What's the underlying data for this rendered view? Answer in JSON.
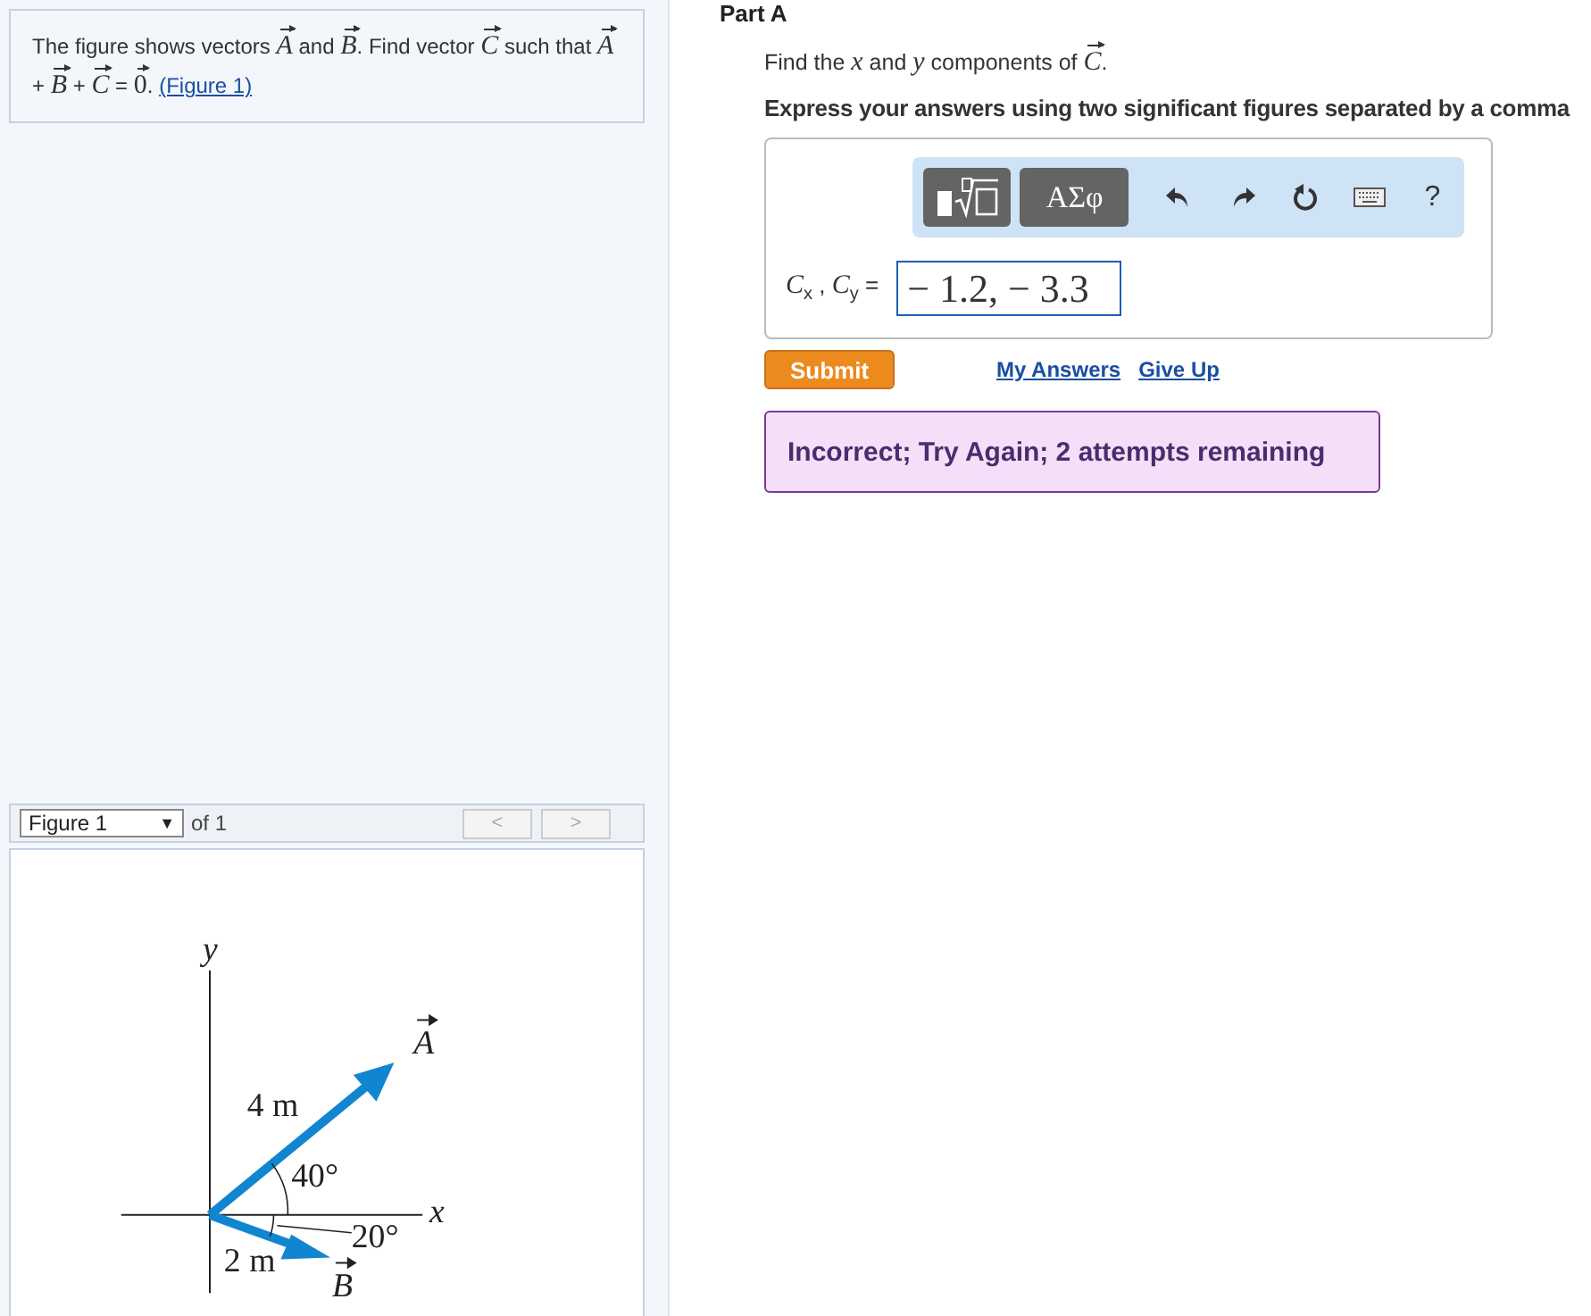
{
  "problem": {
    "parts": [
      {
        "kind": "text",
        "text": "The figure shows vectors "
      },
      {
        "kind": "vector",
        "text": "A"
      },
      {
        "kind": "text",
        "text": " and "
      },
      {
        "kind": "vector",
        "text": "B"
      },
      {
        "kind": "text",
        "text": ". Find vector "
      },
      {
        "kind": "vector",
        "text": "C"
      },
      {
        "kind": "text",
        "text": " such that "
      },
      {
        "kind": "vector",
        "text": "A"
      },
      {
        "kind": "text",
        "text": " + "
      },
      {
        "kind": "vector",
        "text": "B"
      },
      {
        "kind": "text",
        "text": " + "
      },
      {
        "kind": "vector",
        "text": "C"
      },
      {
        "kind": "text",
        "text": " = "
      },
      {
        "kind": "vector_upright",
        "text": "0"
      },
      {
        "kind": "text",
        "text": ". "
      }
    ],
    "figure_link": "(Figure 1)"
  },
  "figure_panel": {
    "selector": "Figure 1",
    "selector_caret": "▼",
    "count": "of 1",
    "prev": "<",
    "next": ">",
    "labels": {
      "y_axis": "y",
      "x_axis": "x",
      "a_length": "4 m",
      "a_angle": "40°",
      "b_angle": "20°",
      "b_length": "2 m",
      "a_name": "A",
      "b_name": "B"
    }
  },
  "part": {
    "title": "Part A",
    "question": [
      {
        "kind": "text",
        "text": "Find the "
      },
      {
        "kind": "math",
        "text": "x"
      },
      {
        "kind": "text",
        "text": " and "
      },
      {
        "kind": "math",
        "text": "y"
      },
      {
        "kind": "text",
        "text": " components of "
      },
      {
        "kind": "vector",
        "text": "C"
      },
      {
        "kind": "text",
        "text": "."
      }
    ],
    "instruction": "Express your answers using two significant figures separated by a comma",
    "toolbar": [
      {
        "kind": "template"
      },
      {
        "kind": "text",
        "label": "ΑΣφ"
      },
      {
        "kind": "undo"
      },
      {
        "kind": "redo"
      },
      {
        "kind": "reset"
      },
      {
        "kind": "keyboard"
      },
      {
        "kind": "plain",
        "label": "?"
      }
    ],
    "answer_label": "*C*$_{x}$ , *C*$_{y}$ =",
    "answer_value": "− 1.2, − 3.3",
    "submit": "Submit",
    "links": [
      "My Answers",
      "Give Up"
    ],
    "feedback": "Incorrect; Try Again; 2 attempts remaining"
  }
}
